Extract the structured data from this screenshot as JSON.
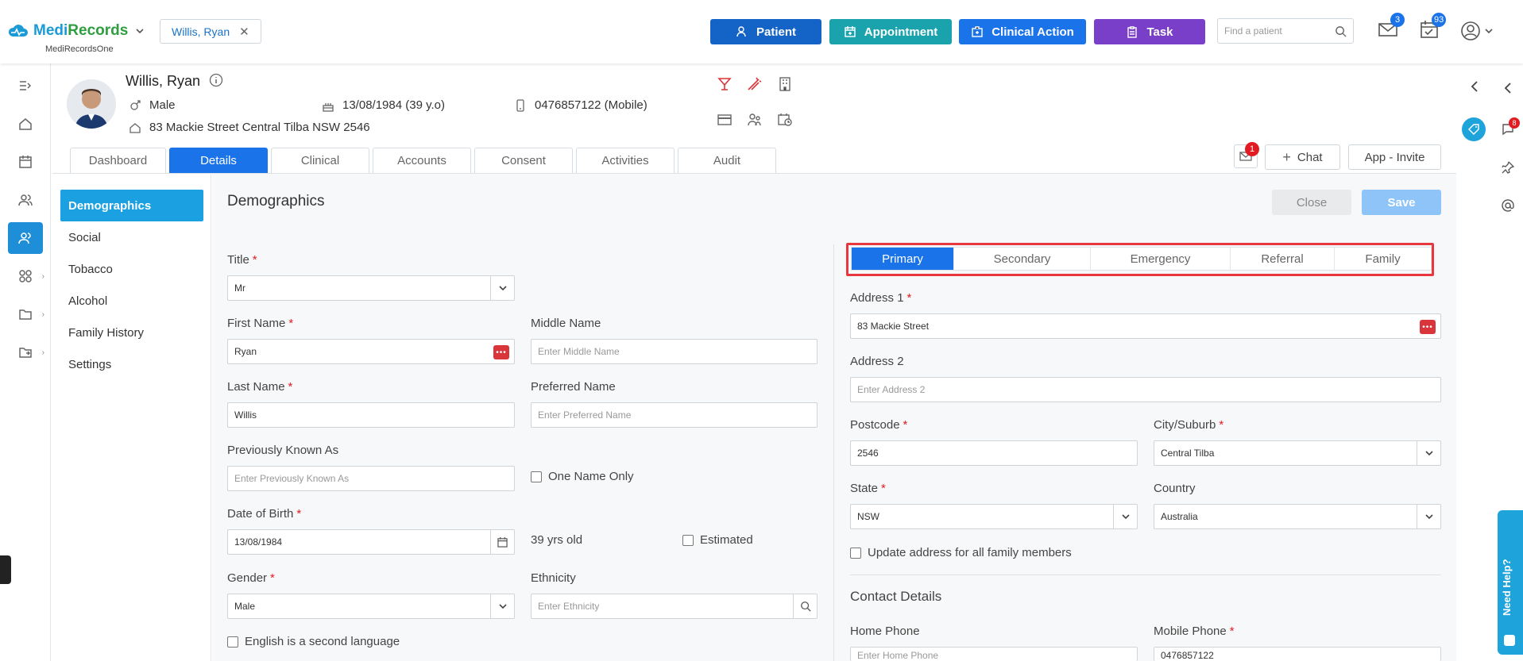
{
  "app": {
    "logo_main": "Medi",
    "logo_accent": "Records",
    "logo_sub": "MediRecordsOne"
  },
  "patient_tab": {
    "name": "Willis, Ryan"
  },
  "toolbar": {
    "patient": "Patient",
    "appointment": "Appointment",
    "clinical_action": "Clinical Action",
    "task": "Task",
    "search_placeholder": "Find a patient",
    "mail_count": "3",
    "tasks_count": "93",
    "colors": {
      "patient": "#1464c8",
      "appointment": "#1ba3ad",
      "clinical_action": "#1a73e8",
      "task": "#7a3fc8"
    }
  },
  "header": {
    "name": "Willis, Ryan",
    "gender": "Male",
    "dob": "13/08/1984 (39 y.o)",
    "phone": "0476857122 (Mobile)",
    "address": "83 Mackie Street Central Tilba NSW 2546"
  },
  "tabs": [
    "Dashboard",
    "Details",
    "Clinical",
    "Accounts",
    "Consent",
    "Activities",
    "Audit"
  ],
  "header_actions": {
    "mail_badge": "1",
    "chat": "Chat",
    "invite": "App - Invite"
  },
  "subnav": [
    "Demographics",
    "Social",
    "Tobacco",
    "Alcohol",
    "Family History",
    "Settings"
  ],
  "section": {
    "title": "Demographics",
    "close": "Close",
    "save": "Save"
  },
  "form": {
    "title_label": "Title",
    "title_value": "Mr",
    "first_name_label": "First Name",
    "first_name_value": "Ryan",
    "middle_name_label": "Middle Name",
    "middle_name_placeholder": "Enter Middle Name",
    "last_name_label": "Last Name",
    "last_name_value": "Willis",
    "preferred_name_label": "Preferred Name",
    "preferred_name_placeholder": "Enter Preferred Name",
    "prev_known_label": "Previously Known As",
    "prev_known_placeholder": "Enter Previously Known As",
    "one_name_only": "One Name Only",
    "dob_label": "Date of Birth",
    "dob_value": "13/08/1984",
    "age_text": "39 yrs old",
    "estimated": "Estimated",
    "gender_label": "Gender",
    "gender_value": "Male",
    "ethnicity_label": "Ethnicity",
    "ethnicity_placeholder": "Enter Ethnicity",
    "english_second": "English is a second language"
  },
  "address_tabs": [
    "Primary",
    "Secondary",
    "Emergency",
    "Referral",
    "Family"
  ],
  "address": {
    "address1_label": "Address 1",
    "address1_value": "83 Mackie Street",
    "address2_label": "Address 2",
    "address2_placeholder": "Enter Address 2",
    "postcode_label": "Postcode",
    "postcode_value": "2546",
    "city_label": "City/Suburb",
    "city_value": "Central Tilba",
    "state_label": "State",
    "state_value": "NSW",
    "country_label": "Country",
    "country_value": "Australia",
    "update_family": "Update address for all family members",
    "contact_title": "Contact Details",
    "home_phone_label": "Home Phone",
    "home_phone_placeholder": "Enter Home Phone",
    "mobile_label": "Mobile Phone",
    "mobile_value": "0476857122"
  },
  "right_sidebar": {
    "notification_count": "8"
  },
  "help": {
    "label": "Need Help?"
  }
}
